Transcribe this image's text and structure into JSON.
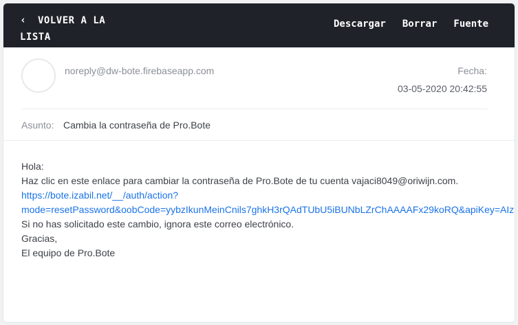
{
  "header": {
    "back_line1": "VOLVER A LA",
    "back_line2": "LISTA",
    "back_chevron": "‹",
    "actions": {
      "download": "Descargar",
      "delete": "Borrar",
      "source": "Fuente"
    }
  },
  "email": {
    "sender": "noreply@dw-bote.firebaseapp.com",
    "date_label": "Fecha:",
    "date_value": "03-05-2020 20:42:55",
    "subject_label": "Asunto:",
    "subject_value": "Cambia la contraseña de Pro.Bote",
    "body": {
      "greeting": "Hola:",
      "line1": "Haz clic en este enlace para cambiar la contraseña de Pro.Bote de tu cuenta vajaci8049@oriwijn.com.",
      "link_line1": "https://bote.izabil.net/__/auth/action?",
      "link_line2": "mode=resetPassword&oobCode=yybzIkunMeinCnils7ghkH3rQAdTUbU5iBUNbLZrChAAAAFx29koRQ&apiKey=AIza",
      "line2": "Si no has solicitado este cambio, ignora este correo electrónico.",
      "thanks": "Gracias,",
      "signature": "El equipo de Pro.Bote"
    }
  },
  "colors": {
    "topbar": "#1f2229",
    "link": "#1a73e8",
    "muted": "#8b8f96",
    "text": "#3d4148"
  }
}
